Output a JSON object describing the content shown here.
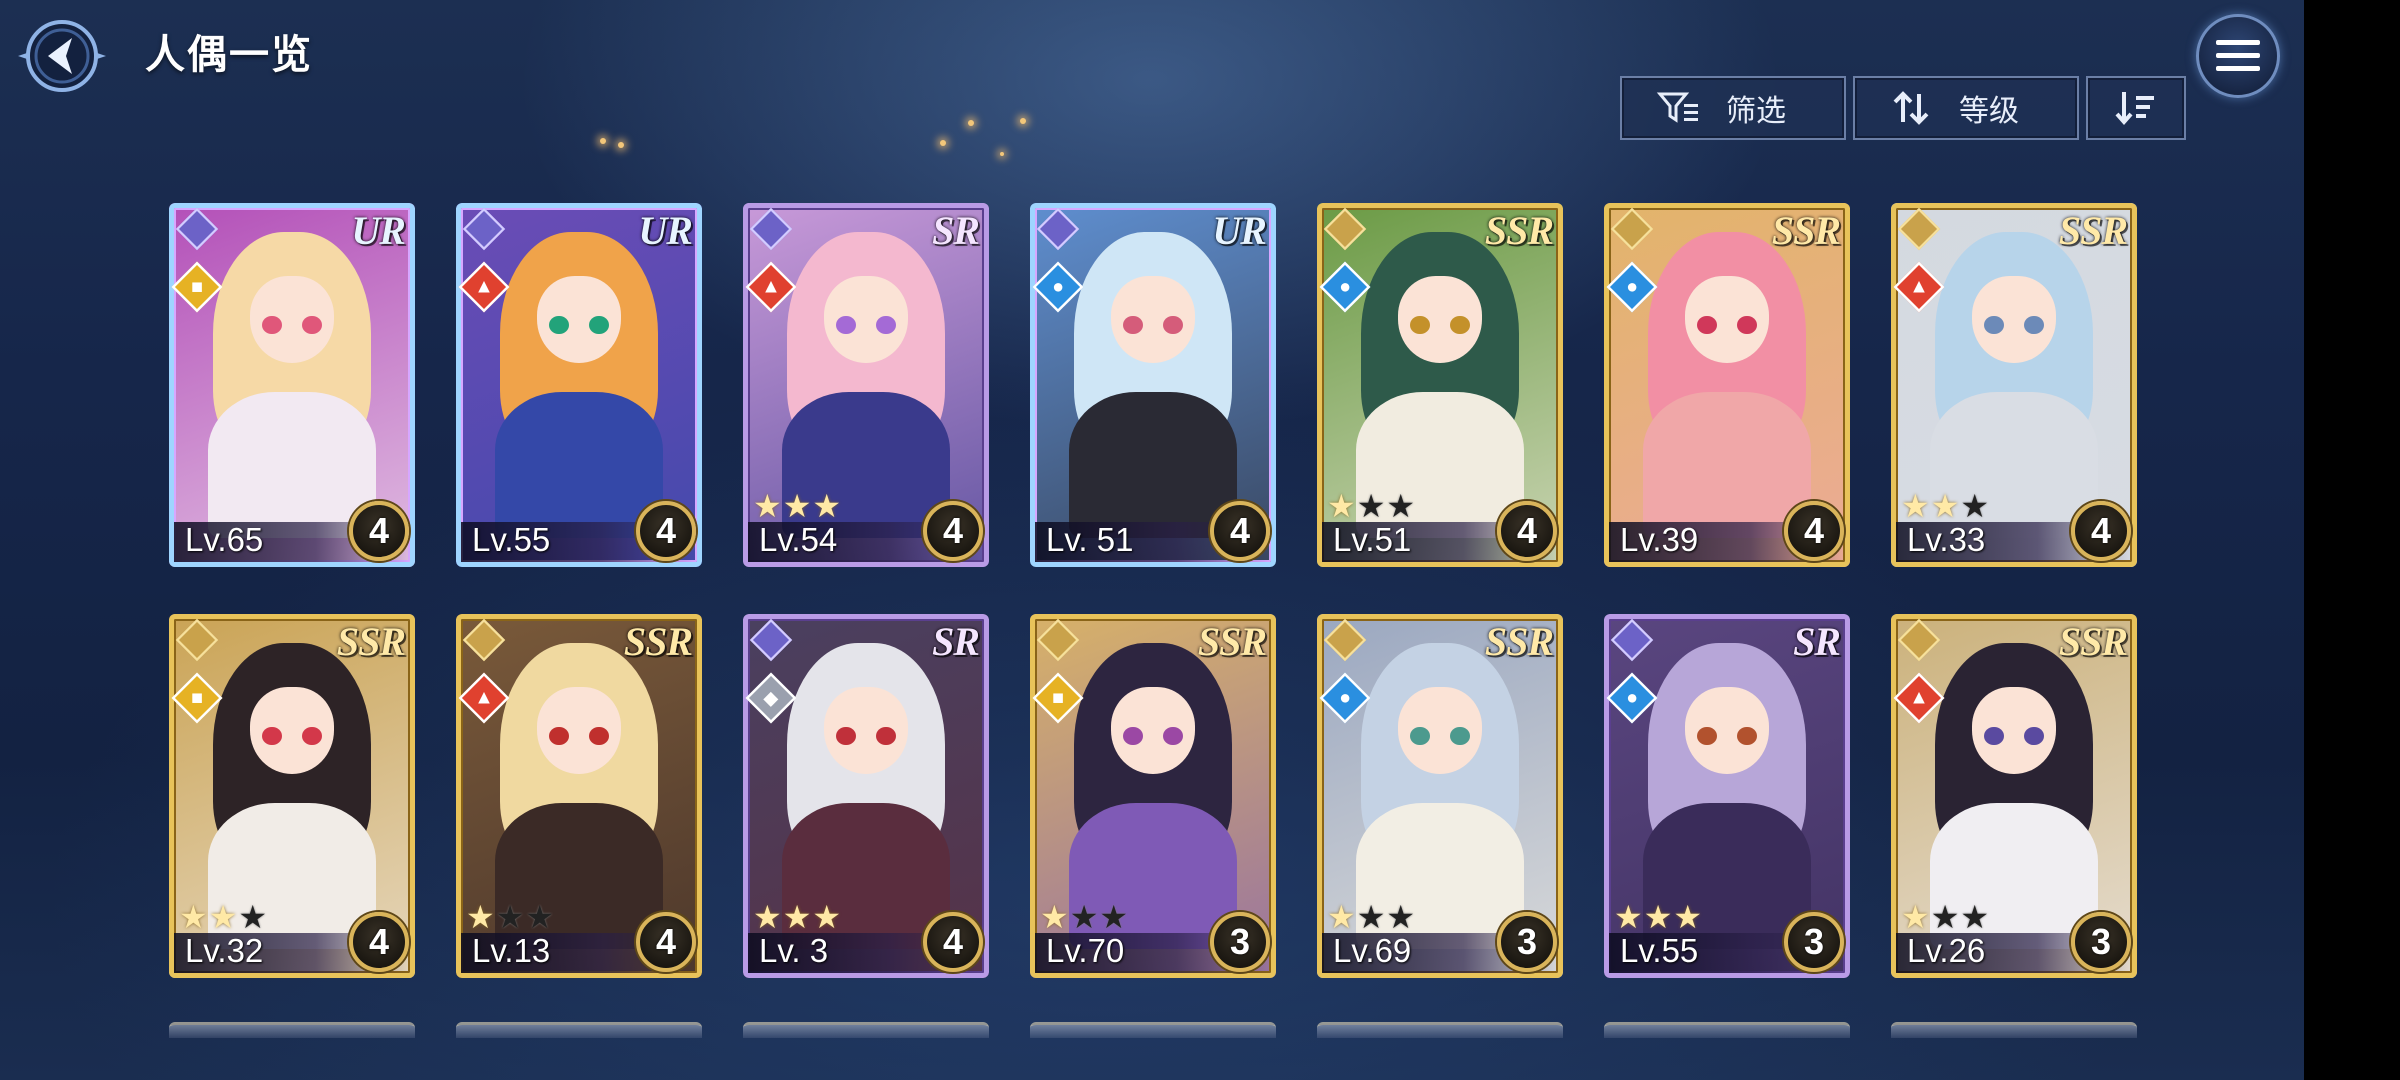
{
  "header": {
    "title": "人偶一览",
    "back_icon": "back-arrow-icon",
    "menu_icon": "hamburger-menu-icon"
  },
  "toolbar": {
    "filter_label": "筛选",
    "filter_icon": "filter-icon",
    "sort_label": "等级",
    "sort_icon": "sort-arrows-icon",
    "order_icon": "sort-order-descending-icon"
  },
  "colors": {
    "background": "#16264a",
    "ur_frame": "#9fd5ff",
    "ssr_frame": "#e8c35a",
    "sr_frame": "#b99be6",
    "fire": "#e0412f",
    "water": "#2a8fe0",
    "light": "#e6b224",
    "dark": "#9aa0ae"
  },
  "dolls": [
    {
      "rarity": "UR",
      "element": "light",
      "level": "Lv.65",
      "stars": 0,
      "rank": "4",
      "hair": "#f6d9a6",
      "outfit": "#f2e9f2",
      "bg": "#b34fb8",
      "eye": "#e0577a"
    },
    {
      "rarity": "UR",
      "element": "fire",
      "level": "Lv.55",
      "stars": 0,
      "rank": "4",
      "hair": "#f0a34a",
      "outfit": "#3448a8",
      "bg": "#6b4cb6",
      "eye": "#22a37a"
    },
    {
      "rarity": "SR",
      "element": "fire",
      "level": "Lv.54",
      "stars": 3,
      "rank": "4",
      "hair": "#f4b8cf",
      "outfit": "#3a3a8c",
      "bg": "#c99ad9",
      "eye": "#a46ad6"
    },
    {
      "rarity": "UR",
      "element": "water",
      "level": "Lv. 51",
      "stars": 0,
      "rank": "4",
      "hair": "#cfe6f6",
      "outfit": "#2a2a34",
      "bg": "#5f8fd0",
      "eye": "#d55c7a"
    },
    {
      "rarity": "SSR",
      "element": "water",
      "level": "Lv.51",
      "stars": 1,
      "rank": "4",
      "hair": "#2e5a4a",
      "outfit": "#f1ece0",
      "bg": "#6a9a44",
      "eye": "#c4912a"
    },
    {
      "rarity": "SSR",
      "element": "water",
      "level": "Lv.39",
      "stars": 0,
      "rank": "4",
      "hair": "#f28fa4",
      "outfit": "#f0a7a8",
      "bg": "#e2b46a",
      "eye": "#d0385a"
    },
    {
      "rarity": "SSR",
      "element": "fire",
      "level": "Lv.33",
      "stars": 2,
      "rank": "4",
      "hair": "#b7d4ea",
      "outfit": "#d9dde4",
      "bg": "#d4d9e0",
      "eye": "#6c8ab8"
    },
    {
      "rarity": "SSR",
      "element": "light",
      "level": "Lv.32",
      "stars": 2,
      "rank": "4",
      "hair": "#2d2326",
      "outfit": "#f1ece7",
      "bg": "#caa354",
      "eye": "#d3384a"
    },
    {
      "rarity": "SSR",
      "element": "fire",
      "level": "Lv.13",
      "stars": 1,
      "rank": "4",
      "hair": "#f0d9a0",
      "outfit": "#3b2a26",
      "bg": "#7a5a3a",
      "eye": "#c0302e"
    },
    {
      "rarity": "SR",
      "element": "dark",
      "level": "Lv. 3",
      "stars": 3,
      "rank": "4",
      "hair": "#e4e4ea",
      "outfit": "#5a2d3e",
      "bg": "#4a4060",
      "eye": "#c0303a"
    },
    {
      "rarity": "SSR",
      "element": "light",
      "level": "Lv.70",
      "stars": 1,
      "rank": "3",
      "hair": "#2d2540",
      "outfit": "#7f5ab6",
      "bg": "#d8b268",
      "eye": "#9b48a4"
    },
    {
      "rarity": "SSR",
      "element": "water",
      "level": "Lv.69",
      "stars": 1,
      "rank": "3",
      "hair": "#c4d2e4",
      "outfit": "#f2eee4",
      "bg": "#9aa7c0",
      "eye": "#4c9a8e"
    },
    {
      "rarity": "SR",
      "element": "water",
      "level": "Lv.55",
      "stars": 3,
      "rank": "3",
      "hair": "#b7a6d8",
      "outfit": "#3a2c5a",
      "bg": "#5a4680",
      "eye": "#b2522e"
    },
    {
      "rarity": "SSR",
      "element": "fire",
      "level": "Lv.26",
      "stars": 1,
      "rank": "3",
      "hair": "#2a2333",
      "outfit": "#f0eef2",
      "bg": "#cbb17a",
      "eye": "#5a4aa0"
    }
  ]
}
